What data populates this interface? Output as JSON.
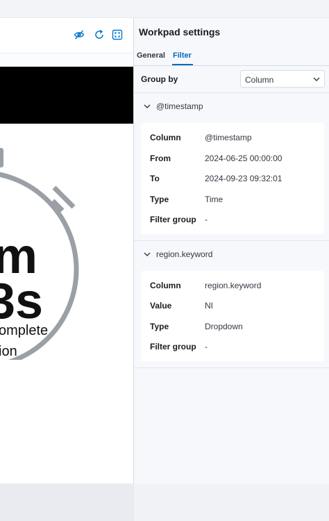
{
  "panel": {
    "title": "Workpad settings",
    "tabs": [
      {
        "label": "General",
        "active": false
      },
      {
        "label": "Filter",
        "active": true
      }
    ],
    "group_by": {
      "label": "Group by",
      "value": "Column"
    }
  },
  "filters": [
    {
      "name": "@timestamp",
      "rows": [
        {
          "key": "Column",
          "value": "@timestamp"
        },
        {
          "key": "From",
          "value": "2024-06-25 00:00:00"
        },
        {
          "key": "To",
          "value": "2024-09-23 09:32:01"
        },
        {
          "key": "Type",
          "value": "Time"
        },
        {
          "key": "Filter group",
          "value": "-"
        }
      ]
    },
    {
      "name": "region.keyword",
      "rows": [
        {
          "key": "Column",
          "value": "region.keyword"
        },
        {
          "key": "Value",
          "value": "NI"
        },
        {
          "key": "Type",
          "value": "Dropdown"
        },
        {
          "key": "Filter group",
          "value": "-"
        }
      ]
    }
  ],
  "canvas": {
    "text_line1": "m",
    "text_line2": "3s",
    "text_line3": "omplete",
    "text_line4": "ion"
  },
  "toolbar_icons": [
    "eye-closed-icon",
    "refresh-icon",
    "fullscreen-icon"
  ],
  "colors": {
    "accent": "#006bb8",
    "icon": "#0077cc",
    "stopwatch": "#9aa0a6"
  }
}
